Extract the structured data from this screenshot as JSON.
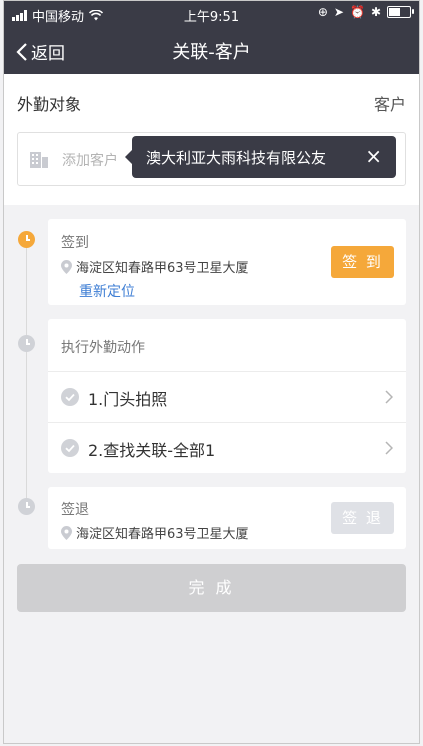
{
  "status_bar": {
    "carrier": "中国移动",
    "time": "上午9:51",
    "icons": [
      "signal-icon",
      "wifi-icon",
      "lock-rotation-icon",
      "location-icon",
      "alarm-icon",
      "bluetooth-icon",
      "battery-icon"
    ],
    "battery_level": 0.6
  },
  "nav": {
    "back_label": "返回",
    "title": "关联-客户"
  },
  "target": {
    "label": "外勤对象",
    "value": "客户",
    "placeholder": "添加客户",
    "tooltip_text": "澳大利亚大雨科技有限公友"
  },
  "checkin": {
    "label": "签到",
    "address": "海淀区知春路甲63号卫星大厦",
    "relocate": "重新定位",
    "button": "签 到"
  },
  "actions": {
    "label": "执行外勤动作",
    "items": [
      {
        "label": "1.门头拍照"
      },
      {
        "label": "2.查找关联-全部1"
      }
    ]
  },
  "checkout": {
    "label": "签退",
    "address": "海淀区知春路甲63号卫星大厦",
    "button": "签 退"
  },
  "complete_button": "完 成",
  "colors": {
    "header_bg": "#3a3b46",
    "accent_orange": "#f5a83a",
    "link_blue": "#3e7ed4",
    "disabled_gray": "#cfcfd1"
  }
}
